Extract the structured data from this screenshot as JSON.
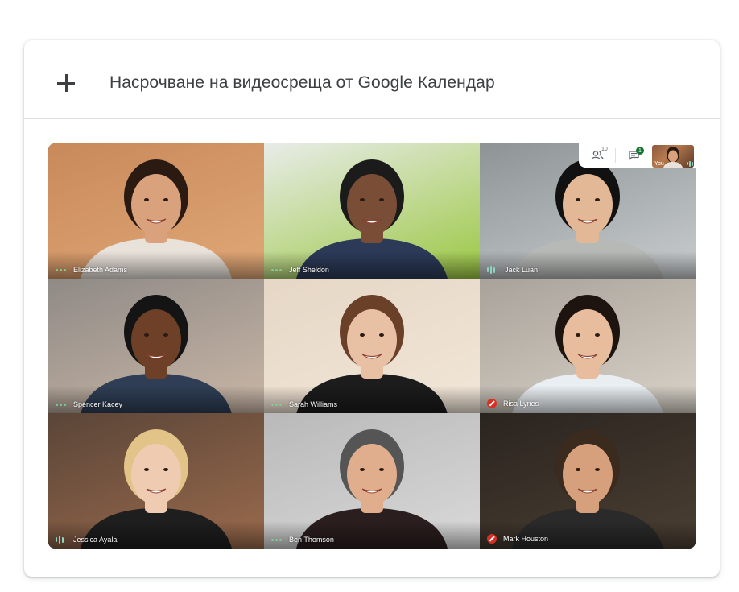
{
  "header": {
    "label": "Насрочване на видеосреща от Google Календар",
    "icon": "plus-icon"
  },
  "call": {
    "participants_count": "10",
    "unread_messages": "1",
    "self_label": "You",
    "tiles": [
      {
        "name": "Elizabeth Adams",
        "audio": "dots",
        "bg": [
          "#c9895a",
          "#e0a877"
        ],
        "skin": "#d9a27c",
        "hair": "#2a1a12",
        "shirt": "#e9e2da"
      },
      {
        "name": "Jeff Sheldon",
        "audio": "dots",
        "bg": [
          "#e8ece8",
          "#9bc742"
        ],
        "skin": "#7a4e36",
        "hair": "#1b1b1b",
        "shirt": "#2c3a58"
      },
      {
        "name": "Jack Luan",
        "audio": "bars",
        "bg": [
          "#8e9496",
          "#c8ccce"
        ],
        "skin": "#e2b896",
        "hair": "#111111",
        "shirt": "#b7b9b7"
      },
      {
        "name": "Spencer Kacey",
        "audio": "dots",
        "bg": [
          "#8f8a86",
          "#c9b6a6"
        ],
        "skin": "#6d4027",
        "hair": "#141414",
        "shirt": "#2f3e55"
      },
      {
        "name": "Sarah Williams",
        "audio": "dots",
        "bg": [
          "#e6d7c5",
          "#f1e6d8"
        ],
        "skin": "#e8c0a4",
        "hair": "#6a4028",
        "shirt": "#1c1c1c"
      },
      {
        "name": "Risa Lynes",
        "audio": "muted",
        "bg": [
          "#a8a29a",
          "#d8d2c8"
        ],
        "skin": "#e7bd9d",
        "hair": "#1d1410",
        "shirt": "#e9eef2"
      },
      {
        "name": "Jessica Ayala",
        "audio": "bars",
        "bg": [
          "#5a4538",
          "#9a6a4c"
        ],
        "skin": "#efcbb1",
        "hair": "#e2c489",
        "shirt": "#1e1e1e"
      },
      {
        "name": "Ben Thomson",
        "audio": "dots",
        "bg": [
          "#b9b9b9",
          "#d9d9d9"
        ],
        "skin": "#e0ae8c",
        "hair": "#555555",
        "shirt": "#2b1e1e"
      },
      {
        "name": "Mark Houston",
        "audio": "muted",
        "bg": [
          "#2a241f",
          "#4b3f33"
        ],
        "skin": "#d7a07c",
        "hair": "#3b2a1e",
        "shirt": "#2a2a2a"
      }
    ]
  }
}
